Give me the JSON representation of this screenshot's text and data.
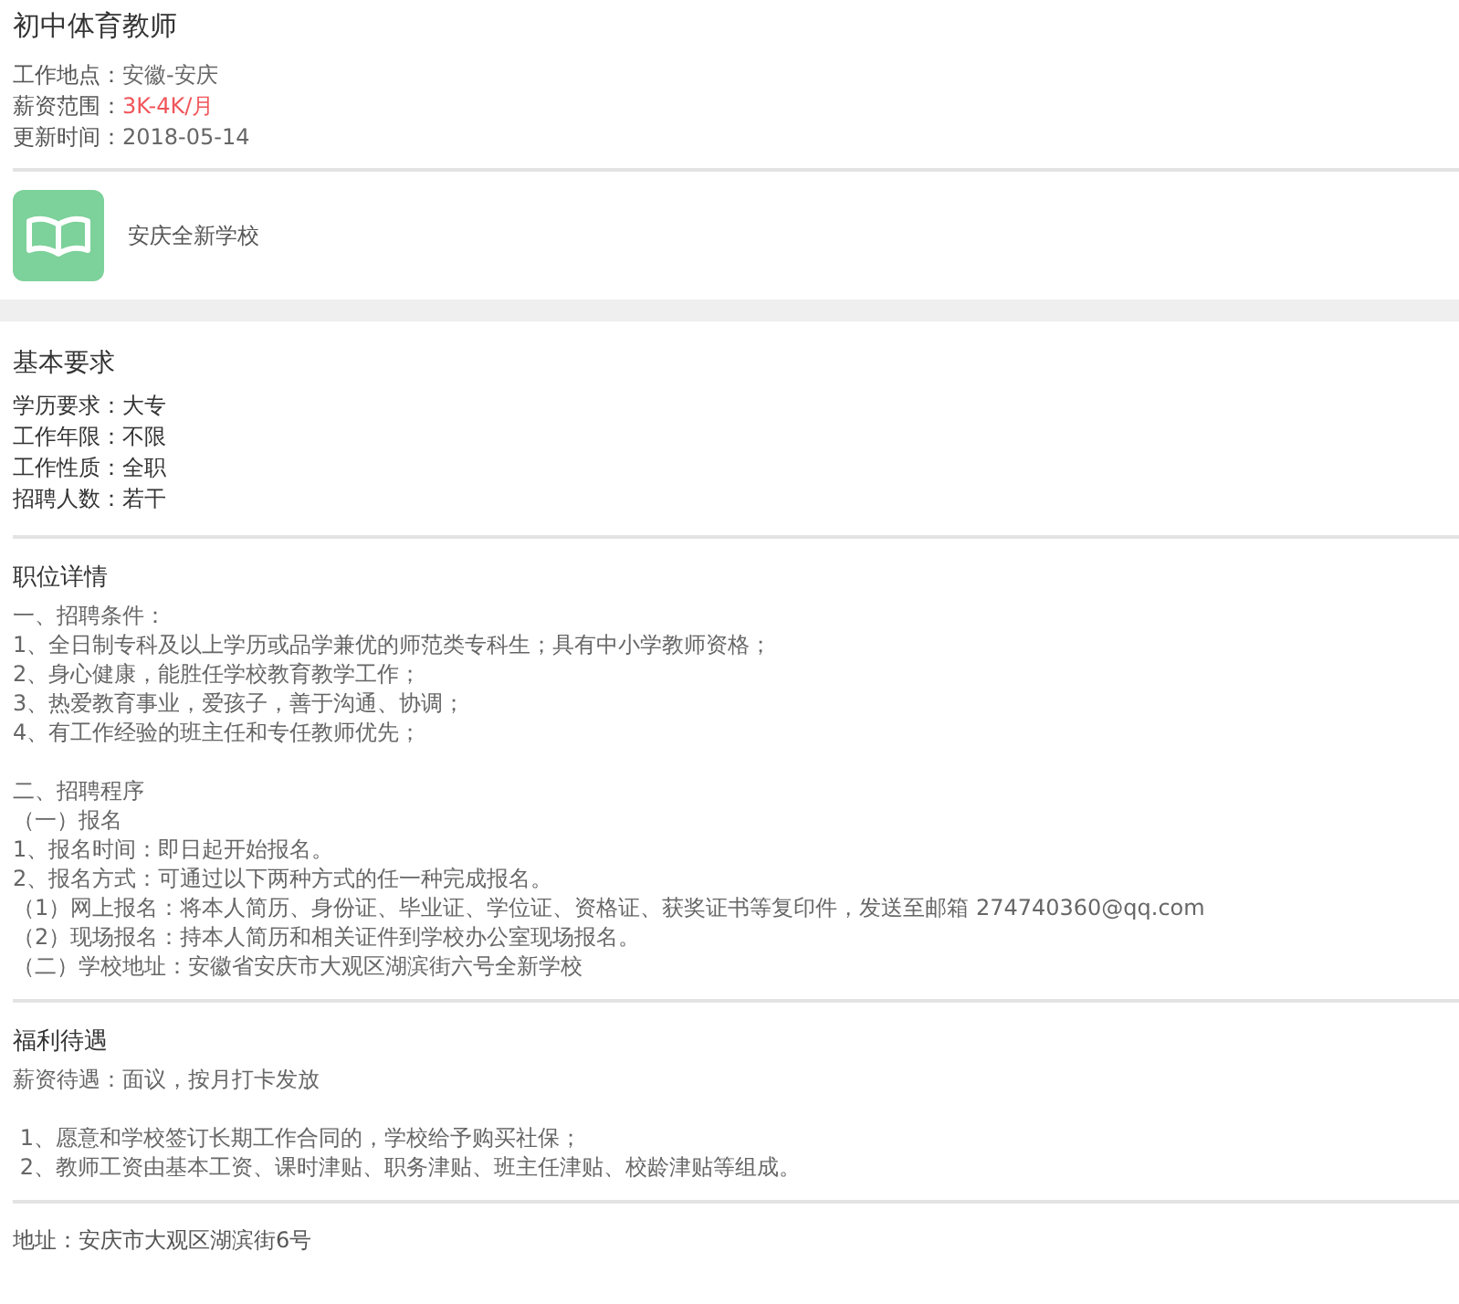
{
  "job": {
    "title": "初中体育教师",
    "info": [
      {
        "label": "工作地点：",
        "value": "安徽-安庆",
        "emphasis": false
      },
      {
        "label": "薪资范围：",
        "value": "3K-4K/月",
        "emphasis": true
      },
      {
        "label": "更新时间：",
        "value": "2018-05-14",
        "emphasis": false
      }
    ]
  },
  "school": {
    "name": "安庆全新学校"
  },
  "requirements": {
    "heading": "基本要求",
    "items": [
      {
        "label": "学历要求：",
        "value": "大专"
      },
      {
        "label": "工作年限：",
        "value": "不限"
      },
      {
        "label": "工作性质：",
        "value": "全职"
      },
      {
        "label": "招聘人数：",
        "value": "若干"
      }
    ]
  },
  "details": {
    "heading": "职位详情",
    "paragraphs": [
      {
        "lines": [
          "一、招聘条件：",
          "1、全日制专科及以上学历或品学兼优的师范类专科生；具有中小学教师资格；",
          "2、身心健康，能胜任学校教育教学工作；",
          "3、热爱教育事业，爱孩子，善于沟通、协调；",
          "4、有工作经验的班主任和专任教师优先；"
        ]
      },
      {
        "lines": [
          "二、招聘程序",
          "（一）报名",
          "1、报名时间：即日起开始报名。",
          "2、报名方式：可通过以下两种方式的任一种完成报名。",
          "（1）网上报名：将本人简历、身份证、毕业证、学位证、资格证、获奖证书等复印件，发送至邮箱 274740360@qq.com",
          "（2）现场报名：持本人简历和相关证件到学校办公室现场报名。",
          "（二）学校地址：安徽省安庆市大观区湖滨街六号全新学校"
        ]
      }
    ]
  },
  "benefits": {
    "heading": "福利待遇",
    "paragraphs": [
      {
        "lines": [
          "薪资待遇：面议，按月打卡发放"
        ]
      },
      {
        "lines": [
          " 1、愿意和学校签订长期工作合同的，学校给予购买社保；",
          " 2、教师工资由基本工资、课时津贴、职务津贴、班主任津贴、校龄津贴等组成。"
        ]
      }
    ]
  },
  "address": "地址：安庆市大观区湖滨街6号"
}
